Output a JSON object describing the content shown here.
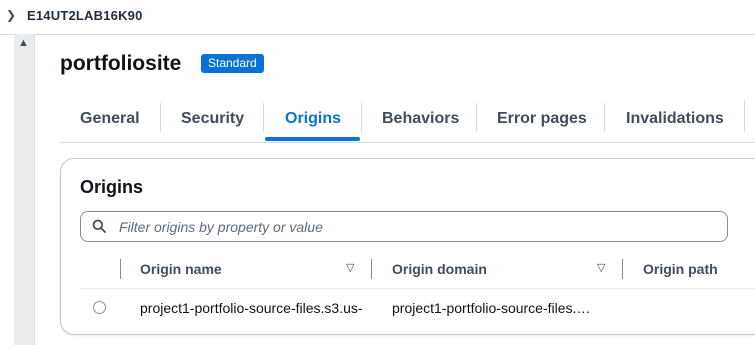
{
  "breadcrumb": {
    "distribution_id": "E14UT2LAB16K90"
  },
  "page": {
    "title": "portfoliosite",
    "badge": "Standard"
  },
  "tabs": [
    {
      "label": "General",
      "active": false
    },
    {
      "label": "Security",
      "active": false
    },
    {
      "label": "Origins",
      "active": true
    },
    {
      "label": "Behaviors",
      "active": false
    },
    {
      "label": "Error pages",
      "active": false
    },
    {
      "label": "Invalidations",
      "active": false
    }
  ],
  "origins": {
    "heading": "Origins",
    "search_placeholder": "Filter origins by property or value",
    "columns": [
      "Origin name",
      "Origin domain",
      "Origin path"
    ],
    "rows": [
      {
        "origin_name": "project1-portfolio-source-files.s3.us-",
        "origin_domain": "project1-portfolio-source-files.…",
        "origin_path": ""
      }
    ]
  },
  "colors": {
    "accent": "#0972d3",
    "text": "#0f141a",
    "muted": "#414d5c"
  }
}
